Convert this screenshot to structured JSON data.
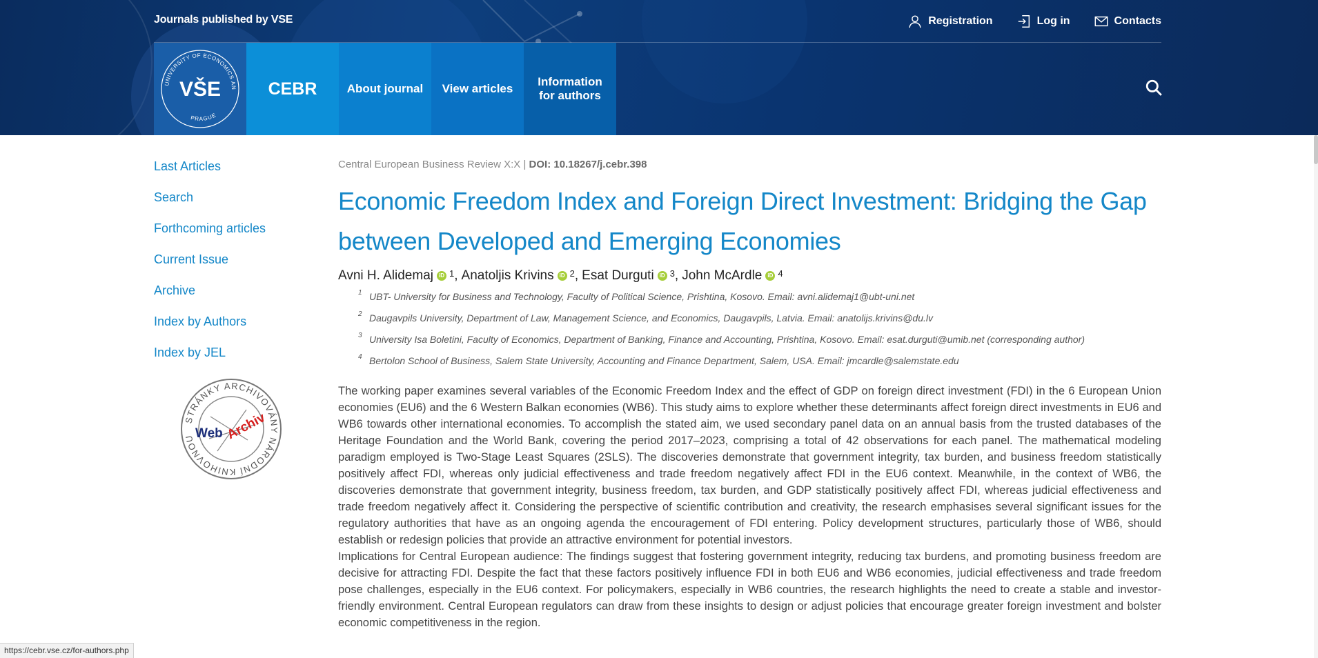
{
  "header": {
    "journals_label": "Journals published by VSE",
    "top_links": [
      {
        "label": "Registration",
        "icon": "user-icon"
      },
      {
        "label": "Log in",
        "icon": "login-icon"
      },
      {
        "label": "Contacts",
        "icon": "mail-icon"
      }
    ],
    "logo": {
      "ring_text": "UNIVERSITY OF ECONOMICS AND BUSINESS",
      "bottom_text": "PRAGUE",
      "mark": "VŠE"
    },
    "nav": {
      "cebr": "CEBR",
      "about": "About journal",
      "view": "View articles",
      "info": "Information for authors"
    }
  },
  "sidebar": {
    "items": [
      "Last Articles",
      "Search",
      "Forthcoming articles",
      "Current Issue",
      "Archive",
      "Index by Authors",
      "Index by JEL"
    ],
    "webarchiv": {
      "ring_text": "STRÁNKY ARCHIVOVÁNY NÁRODNÍ KNIHOVNOU ČR",
      "word_web": "Web",
      "word_archiv": "Archiv"
    }
  },
  "article": {
    "breadcrumb_journal": "Central European Business Review X:X",
    "breadcrumb_sep": " | ",
    "breadcrumb_doi": "DOI: 10.18267/j.cebr.398",
    "title": "Economic Freedom Index and Foreign Direct Investment: Bridging the Gap between Developed and Emerging Economies",
    "authors": [
      {
        "name": "Avni H. Alidemaj",
        "aff": "1"
      },
      {
        "name": "Anatoljis Krivins",
        "aff": "2"
      },
      {
        "name": "Esat Durguti",
        "aff": "3"
      },
      {
        "name": "John McArdle",
        "aff": "4"
      }
    ],
    "orcid_label": "iD",
    "affiliations": [
      {
        "num": "1",
        "text": "UBT- University for Business and Technology, Faculty of Political Science, Prishtina, Kosovo. Email: avni.alidemaj1@ubt-uni.net"
      },
      {
        "num": "2",
        "text": "Daugavpils University, Department of Law, Management Science, and Economics, Daugavpils, Latvia. Email: anatolijs.krivins@du.lv"
      },
      {
        "num": "3",
        "text": "University Isa Boletini, Faculty of Economics, Department of Banking, Finance and Accounting, Prishtina, Kosovo. Email: esat.durguti@umib.net (corresponding author)"
      },
      {
        "num": "4",
        "text": "Bertolon School of Business, Salem State University, Accounting and Finance Department, Salem, USA. Email: jmcardle@salemstate.edu"
      }
    ],
    "abstract_p1": "The working paper examines several variables of the Economic Freedom Index and the effect of GDP on foreign direct investment (FDI) in the 6 European Union economies (EU6) and the 6 Western Balkan economies (WB6). This study aims to explore whether these determinants affect foreign direct investments in EU6 and WB6 towards other international economies. To accomplish the stated aim, we used secondary panel data on an annual basis from the trusted databases of the Heritage Foundation and the World Bank, covering the period 2017–2023, comprising a total of 42 observations for each panel. The mathematical modeling paradigm employed is Two-Stage Least Squares (2SLS). The discoveries demonstrate that government integrity, tax burden, and business freedom statistically positively affect FDI, whereas only judicial effectiveness and trade freedom negatively affect FDI in the EU6 context. Meanwhile, in the context of WB6, the discoveries demonstrate that government integrity, business freedom, tax burden, and GDP statistically positively affect FDI, whereas judicial effectiveness and trade freedom negatively affect it. Considering the perspective of scientific contribution and creativity, the research emphasises several significant issues for the regulatory authorities that have as an ongoing agenda the encouragement of FDI entering. Policy development structures, particularly those of WB6, should establish or redesign policies that provide an attractive environment for potential investors.",
    "abstract_p2": "Implications for Central European audience: The findings suggest that fostering government integrity, reducing tax burdens, and promoting business freedom are decisive for attracting FDI. Despite the fact that these factors positively influence FDI in both EU6 and WB6 economies, judicial effectiveness and trade freedom pose challenges, especially in the EU6 context. For policymakers, especially in WB6 countries, the research highlights the need to create a stable and investor-friendly environment. Central European regulators can draw from these insights to design or adjust policies that encourage greater foreign investment and bolster economic competitiveness in the region."
  },
  "status_url": "https://cebr.vse.cz/for-authors.php",
  "colors": {
    "accent": "#1487c8",
    "header_bg": "#0a2c5e",
    "orcid": "#a6ce39"
  }
}
